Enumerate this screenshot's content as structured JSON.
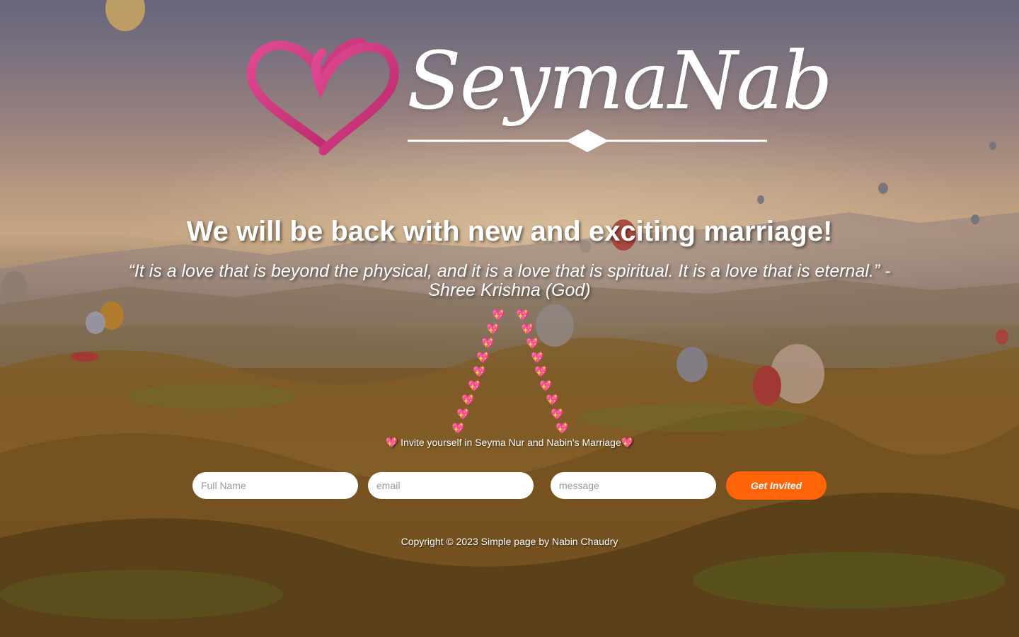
{
  "brand": {
    "name": "SeymaNab"
  },
  "headline": "We will be back with new and exciting marriage!",
  "quote": "“It is a love that is beyond the physical, and it is a love that is spiritual. It is a love that is eternal.” - Shree Krishna (God)",
  "hearts": {
    "glyph": "💖"
  },
  "invite_text": "💖 Invite yourself in Seyma Nur and Nabin's Marriage💖",
  "form": {
    "name_placeholder": "Full Name",
    "email_placeholder": "email",
    "message_placeholder": "message",
    "submit_label": "Get Invited"
  },
  "footer": "Copyright © 2023 Simple page by Nabin Chaudry",
  "colors": {
    "accent": "#ff6408",
    "logo_pink": "#d4367f"
  }
}
